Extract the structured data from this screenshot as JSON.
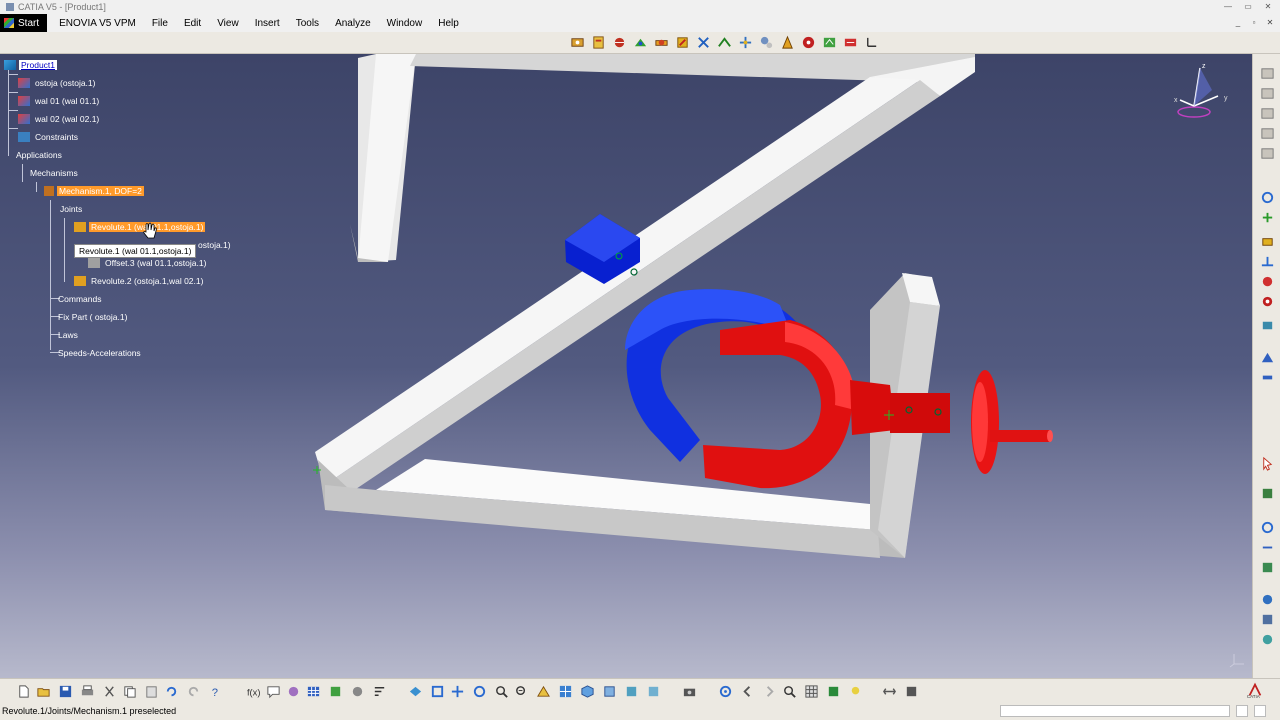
{
  "window": {
    "title": "CATIA V5 - [Product1]"
  },
  "menu": {
    "start": "Start",
    "items": [
      "ENOVIA V5 VPM",
      "File",
      "Edit",
      "View",
      "Insert",
      "Tools",
      "Analyze",
      "Window",
      "Help"
    ]
  },
  "tree": {
    "root": "Product1",
    "part1": "ostoja (ostoja.1)",
    "part2": "wal 01 (wal 01.1)",
    "part3": "wal 02 (wal 02.1)",
    "constraints": "Constraints",
    "applications": "Applications",
    "mechanisms": "Mechanisms",
    "mechanism1": "Mechanism.1, DOF=2",
    "joints": "Joints",
    "revolute1": "Revolute.1 (wal 01.1,ostoja.1)",
    "hidden_row_tail": "ostoja.1)",
    "offset3": "Offset.3 (wal 01.1,ostoja.1)",
    "revolute2": "Revolute.2 (ostoja.1,wal 02.1)",
    "commands": "Commands",
    "fixpart": "Fix Part ( ostoja.1)",
    "laws": "Laws",
    "speeds": "Speeds-Accelerations"
  },
  "tooltip": "Revolute.1 (wal 01.1,ostoja.1)",
  "compass": {
    "x": "x",
    "y": "y",
    "z": "z"
  },
  "status": {
    "text": "Revolute.1/Joints/Mechanism.1 preselected"
  },
  "colors": {
    "frame": "#f2f2f2",
    "blue_part": "#1030e0",
    "red_part": "#e01010",
    "selection": "#ff9a2a"
  }
}
